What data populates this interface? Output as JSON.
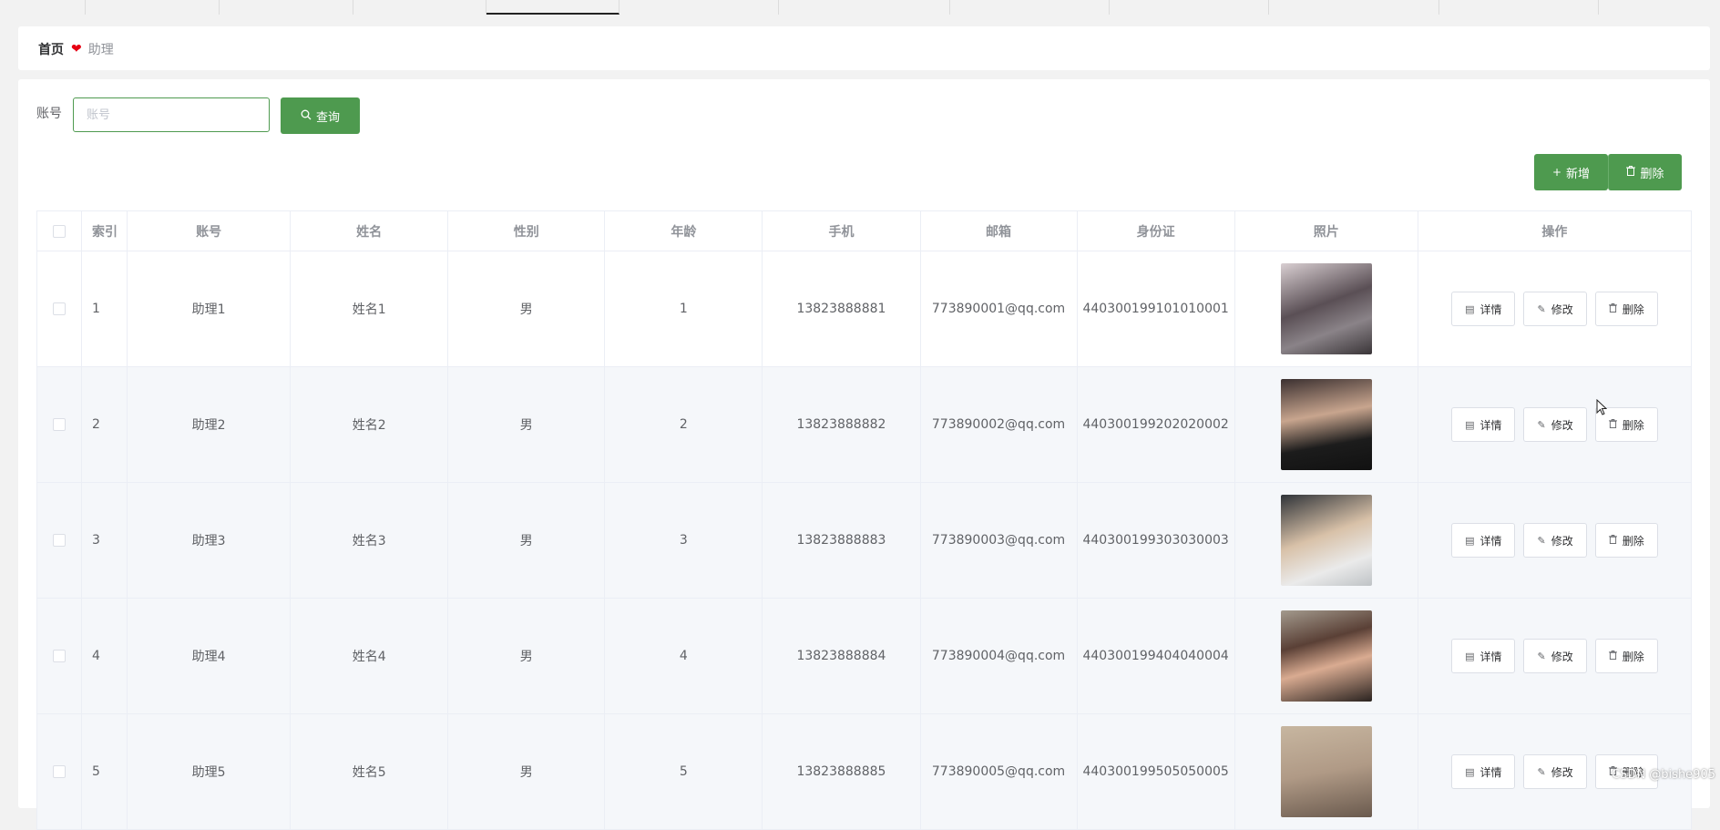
{
  "breadcrumb": {
    "home": "首页",
    "separator_icon": "heart-icon",
    "current": "助理"
  },
  "search": {
    "label": "账号",
    "placeholder": "账号",
    "value": "",
    "button_label": "查询",
    "button_icon": "search-icon"
  },
  "toolbar": {
    "add_label": "新增",
    "add_icon": "plus-icon",
    "delete_label": "删除",
    "delete_icon": "trash-icon"
  },
  "table": {
    "headers": [
      "索引",
      "账号",
      "姓名",
      "性别",
      "年龄",
      "手机",
      "邮箱",
      "身份证",
      "照片",
      "操作"
    ],
    "rows": [
      {
        "index": "1",
        "account": "助理1",
        "name": "姓名1",
        "gender": "男",
        "age": "1",
        "phone": "13823888881",
        "email": "773890001@qq.com",
        "id_card": "440300199101010001"
      },
      {
        "index": "2",
        "account": "助理2",
        "name": "姓名2",
        "gender": "男",
        "age": "2",
        "phone": "13823888882",
        "email": "773890002@qq.com",
        "id_card": "440300199202020002"
      },
      {
        "index": "3",
        "account": "助理3",
        "name": "姓名3",
        "gender": "男",
        "age": "3",
        "phone": "13823888883",
        "email": "773890003@qq.com",
        "id_card": "440300199303030003"
      },
      {
        "index": "4",
        "account": "助理4",
        "name": "姓名4",
        "gender": "男",
        "age": "4",
        "phone": "13823888884",
        "email": "773890004@qq.com",
        "id_card": "440300199404040004"
      },
      {
        "index": "5",
        "account": "助理5",
        "name": "姓名5",
        "gender": "男",
        "age": "5",
        "phone": "13823888885",
        "email": "773890005@qq.com",
        "id_card": "440300199505050005"
      }
    ],
    "row_actions": {
      "detail": "详情",
      "edit": "修改",
      "delete": "删除"
    }
  },
  "watermark": "CSDN @bishe905",
  "colors": {
    "primary": "#4e9a4f",
    "heart": "#e60012"
  }
}
